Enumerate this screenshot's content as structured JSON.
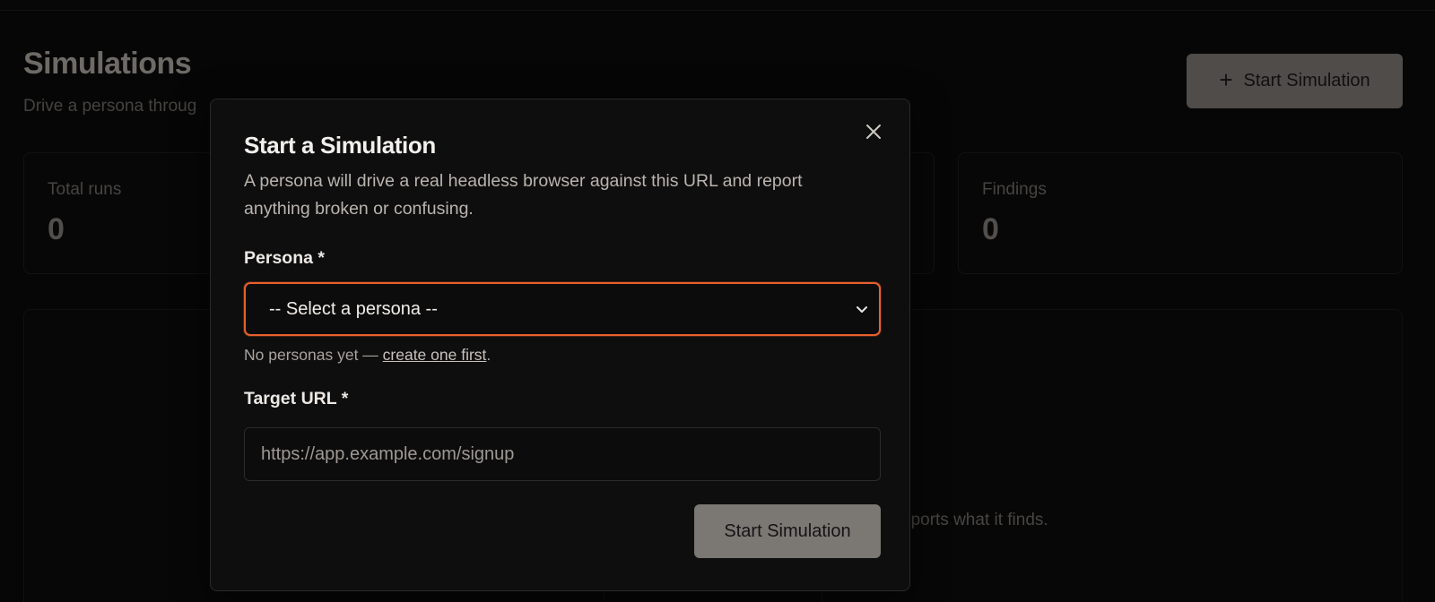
{
  "page": {
    "title": "Simulations",
    "subtitle": "Drive a persona throug",
    "start_button_label": "Start Simulation",
    "start_button_icon": "plus-icon"
  },
  "stats": [
    {
      "label": "Total runs",
      "value": "0"
    },
    {
      "label": "Findings",
      "value": "0"
    }
  ],
  "empty_state": {
    "text": "eports what it finds."
  },
  "modal": {
    "title": "Start a Simulation",
    "description": "A persona will drive a real headless browser against this URL and report anything broken or confusing.",
    "persona_label": "Persona *",
    "persona_selected": "-- Select a persona --",
    "hint_prefix": "No personas yet — ",
    "hint_link": "create one first",
    "hint_suffix": ".",
    "url_label": "Target URL *",
    "url_placeholder": "https://app.example.com/signup",
    "url_value": "",
    "submit_label": "Start Simulation",
    "close_icon": "close-icon"
  },
  "colors": {
    "accent_focus": "#e8602c",
    "button_bg": "#7b7773",
    "background": "#0a0a0a"
  }
}
